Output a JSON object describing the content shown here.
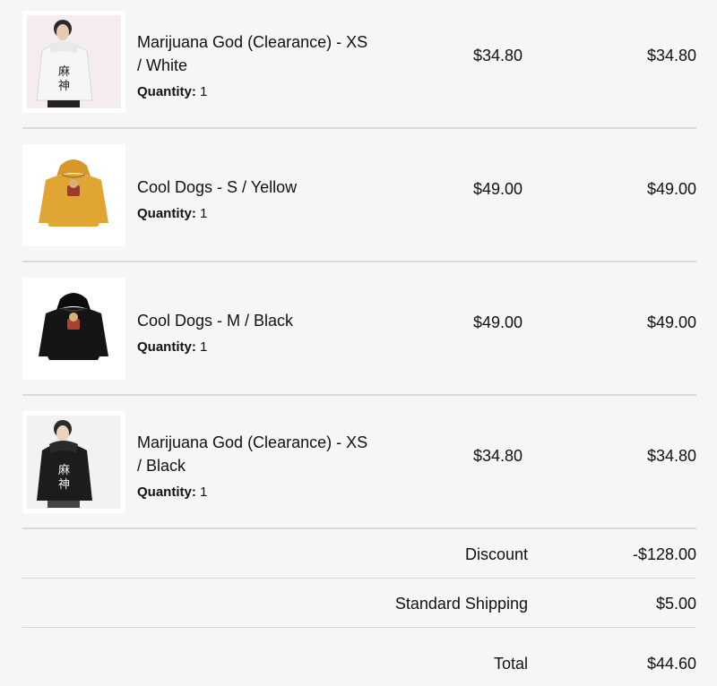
{
  "order_items": [
    {
      "title": "Marijuana God (Clearance) - XS / White",
      "quantity_label": "Quantity:",
      "quantity": "1",
      "price": "$34.80",
      "line_total": "$34.80",
      "image": "white-hoodie-model-photo",
      "hoodie_color": "#f1f1f1"
    },
    {
      "title": "Cool Dogs - S / Yellow",
      "quantity_label": "Quantity:",
      "quantity": "1",
      "price": "$49.00",
      "line_total": "$49.00",
      "image": "yellow-hoodie-product-photo",
      "hoodie_color": "#e0a532"
    },
    {
      "title": "Cool Dogs - M / Black",
      "quantity_label": "Quantity:",
      "quantity": "1",
      "price": "$49.00",
      "line_total": "$49.00",
      "image": "black-hoodie-product-photo",
      "hoodie_color": "#151515"
    },
    {
      "title": "Marijuana God (Clearance) - XS / Black",
      "quantity_label": "Quantity:",
      "quantity": "1",
      "price": "$34.80",
      "line_total": "$34.80",
      "image": "black-hoodie-model-photo",
      "hoodie_color": "#1c1c1c"
    }
  ],
  "summary": {
    "discount_label": "Discount",
    "discount_value": "-$128.00",
    "shipping_label": "Standard Shipping",
    "shipping_value": "$5.00",
    "total_label": "Total",
    "total_value": "$44.60"
  },
  "colors": {
    "background": "#f6f6f6",
    "divider": "#d9d9d9",
    "text": "#111111"
  }
}
